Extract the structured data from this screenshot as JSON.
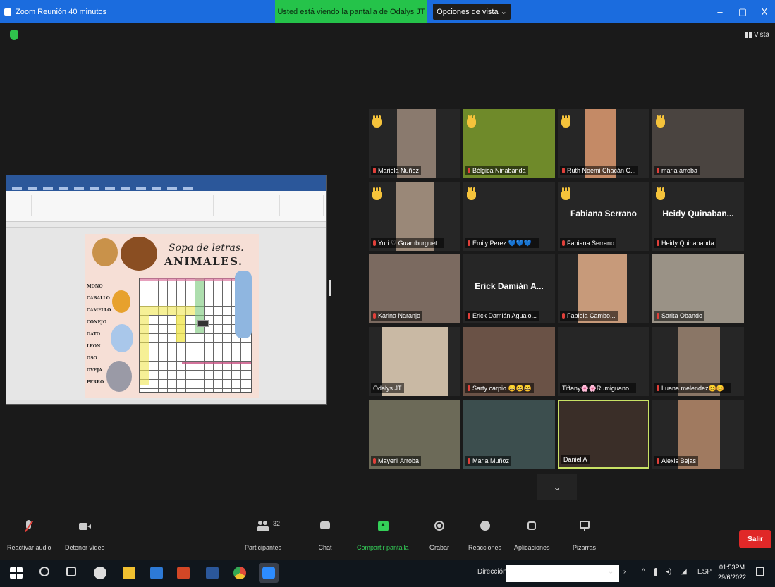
{
  "window": {
    "title": "Zoom Reunión 40 minutos",
    "share_banner": "Usted está viendo la pantalla de Odalys JT",
    "view_options": "Opciones de vista ⌄",
    "minimize": "–",
    "maximize": "▢",
    "close": "X"
  },
  "meeting": {
    "view_label": "Vista"
  },
  "shared_doc": {
    "title": "Sopa de letras.",
    "subtitle": "ANIMALES.",
    "words": [
      "MONO",
      "CABALLO",
      "CAMELLO",
      "CONEJO",
      "GATO",
      "LEON",
      "OSO",
      "OVEJA",
      "PERRO"
    ]
  },
  "participants": [
    {
      "name": "Mariela Nuñez",
      "hand": true,
      "big": ""
    },
    {
      "name": "Bélgica Ninabanda",
      "hand": true,
      "big": ""
    },
    {
      "name": "Ruth Noemi Chacán C...",
      "hand": true,
      "big": ""
    },
    {
      "name": "maria arroba",
      "hand": true,
      "big": ""
    },
    {
      "name": "Yuri ♡ Guamburguet...",
      "hand": true,
      "big": ""
    },
    {
      "name": "Emily Perez 💙💙💙...",
      "hand": true,
      "big": ""
    },
    {
      "name": "Fabiana Serrano",
      "hand": true,
      "big": "Fabiana Serrano"
    },
    {
      "name": "Heidy Quinabanda",
      "hand": true,
      "big": "Heidy Quinaban..."
    },
    {
      "name": "Karina Naranjo",
      "hand": false,
      "big": ""
    },
    {
      "name": "Erick Damián Agualo...",
      "hand": false,
      "big": "Erick Damián A..."
    },
    {
      "name": "Fabiola Cambo...",
      "hand": false,
      "big": ""
    },
    {
      "name": "Sarita Obando",
      "hand": false,
      "big": ""
    },
    {
      "name": "Odalys JT",
      "hand": false,
      "big": ""
    },
    {
      "name": "Sarty carpio 😀😀😀",
      "hand": false,
      "big": ""
    },
    {
      "name": "Tiffany🌸🌸Rumiguano...",
      "hand": false,
      "big": ""
    },
    {
      "name": "Luana melendez😊😊...",
      "hand": false,
      "big": ""
    },
    {
      "name": "Mayerli Arroba",
      "hand": false,
      "big": ""
    },
    {
      "name": "Maria Muñoz",
      "hand": false,
      "big": ""
    },
    {
      "name": "Daniel A",
      "hand": false,
      "big": ""
    },
    {
      "name": "Alexis Bejas",
      "hand": false,
      "big": ""
    }
  ],
  "toolbar": {
    "audio": "Reactivar audio",
    "video": "Detener vídeo",
    "participants": "Participantes",
    "participants_count": "32",
    "chat": "Chat",
    "share": "Compartir pantalla",
    "record": "Grabar",
    "reactions": "Reacciones",
    "apps": "Aplicaciones",
    "whiteboard": "Pizarras",
    "leave": "Salir"
  },
  "taskbar": {
    "address_label": "Dirección",
    "lang": "ESP",
    "time": "01:53PM",
    "date": "29/6/2022"
  },
  "colors": {
    "titlebar": "#1b6cde",
    "share_banner": "#25c34a",
    "leave": "#e02828",
    "active_speaker": "#c9e265",
    "raised_hand": "#f5c33b"
  }
}
